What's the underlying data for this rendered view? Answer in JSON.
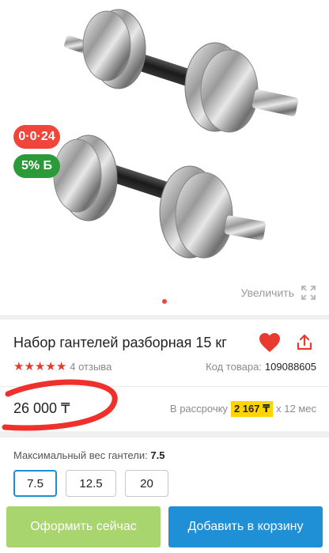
{
  "product": {
    "title": "Набор гантелей разборная 15 кг",
    "code_label": "Код товара:",
    "code_value": "109088605",
    "rating_count": "4 отзыва",
    "rating_stars": 5
  },
  "badges": {
    "installment": "0·0·24",
    "bonus": "5% Б"
  },
  "gallery": {
    "zoom_label": "Увеличить"
  },
  "pricing": {
    "price": "26 000 ₸",
    "credit_prefix": "В рассрочку",
    "credit_amount": "2 167 ₸",
    "credit_suffix": "x 12 мес"
  },
  "weight": {
    "label": "Максимальный вес гантели:",
    "selected": "7.5",
    "options": [
      "7.5",
      "12.5",
      "20"
    ]
  },
  "actions": {
    "buy_now": "Оформить сейчас",
    "add_to_cart": "Добавить в корзину"
  },
  "colors": {
    "accent_red": "#f0453a",
    "bonus_green": "#2b9b3a",
    "cart_blue": "#1f8fd6",
    "buy_green": "#a8d56e",
    "credit_yellow": "#ffd500"
  }
}
